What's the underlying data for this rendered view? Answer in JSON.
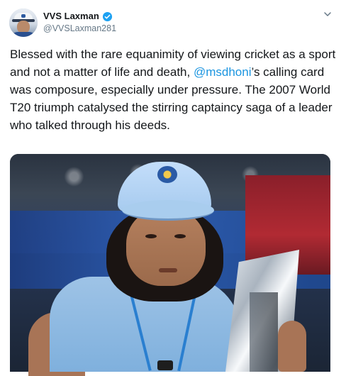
{
  "author": {
    "name": "VVS Laxman",
    "handle": "@VVSLaxman281",
    "verified": true,
    "avatar_icon": "profile-avatar"
  },
  "menu_icon": "chevron-down-icon",
  "tweet": {
    "text_before": "Blessed with the rare equanimity of viewing cricket as a sport and not a matter of life and death, ",
    "mention": "@msdhoni",
    "text_after": "’s calling card was composure, especially under pressure. The 2007 World T20 triumph catalysed the stirring captaincy saga of a leader who talked through his deeds."
  },
  "media": {
    "type": "photo"
  },
  "colors": {
    "link": "#1b95e0",
    "verified": "#1da1f2",
    "secondary_text": "#657786",
    "primary_text": "#14171a"
  }
}
